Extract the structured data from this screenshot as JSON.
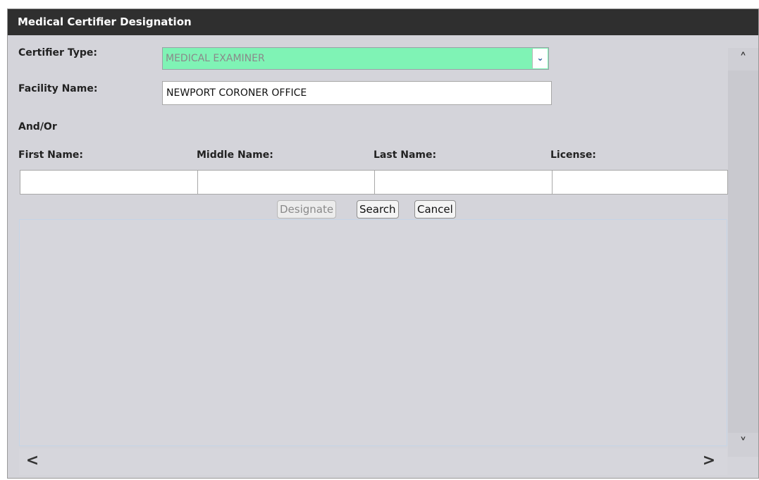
{
  "dialog": {
    "title": "Medical Certifier Designation"
  },
  "form": {
    "certifier_type_label": "Certifier Type:",
    "certifier_type_value": "MEDICAL EXAMINER",
    "facility_name_label": "Facility Name:",
    "facility_name_value": "NEWPORT CORONER OFFICE",
    "and_or_label": "And/Or",
    "first_name_label": "First Name:",
    "middle_name_label": "Middle Name:",
    "last_name_label": "Last Name:",
    "license_label": "License:",
    "first_name_value": "",
    "middle_name_value": "",
    "last_name_value": "",
    "license_value": ""
  },
  "buttons": {
    "designate": "Designate",
    "search": "Search",
    "cancel": "Cancel"
  },
  "scroll": {
    "up": "⌃",
    "down": "⌄",
    "left": "<",
    "right": ">"
  },
  "colors": {
    "titlebar_bg": "#2f2f2f",
    "select_bg": "#7ff3b5"
  },
  "icons": {
    "dropdown": "chevron-down-icon",
    "scroll_up": "chevron-up-icon",
    "scroll_down": "chevron-down-icon",
    "scroll_left": "chevron-left-icon",
    "scroll_right": "chevron-right-icon"
  }
}
